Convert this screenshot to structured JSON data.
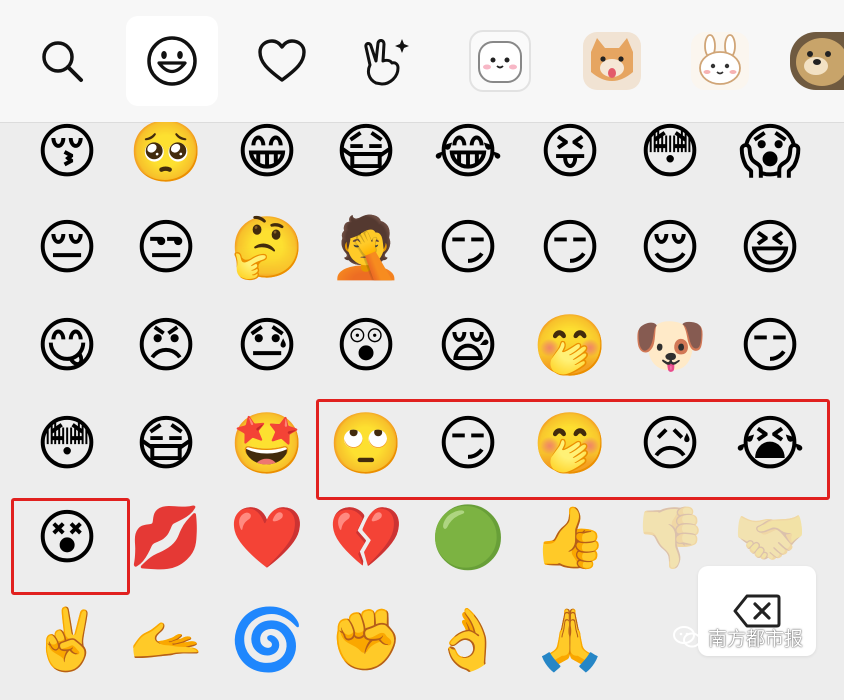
{
  "tabs": [
    {
      "name": "search-tab",
      "icon": "search-icon"
    },
    {
      "name": "emoji-tab",
      "icon": "smiley-face-icon",
      "active": true
    },
    {
      "name": "favorites-tab",
      "icon": "heart-icon"
    },
    {
      "name": "stickers-tab",
      "icon": "victory-hand-icon"
    },
    {
      "name": "sticker-pack-white-dog",
      "icon": "white-dog-sticker"
    },
    {
      "name": "sticker-pack-cat",
      "icon": "cat-sticker"
    },
    {
      "name": "sticker-pack-rabbit",
      "icon": "rabbit-sticker"
    },
    {
      "name": "sticker-pack-dog-photo",
      "icon": "dog-photo-sticker"
    }
  ],
  "emoji_rows": [
    [
      "😚",
      "🥺",
      "😁",
      "😷",
      "😂",
      "😝",
      "😳",
      "😱"
    ],
    [
      "😔",
      "😒",
      "🤔",
      "🤦",
      "😏",
      "😏",
      "😌",
      "😆"
    ],
    [
      "😋",
      "😠",
      "😓",
      "😲",
      "😪",
      "🤭",
      "🐶",
      "😏"
    ],
    [
      "😳",
      "😷",
      "🤩",
      "🙄",
      "😏",
      "🤭",
      "😥",
      "😭"
    ],
    [
      "😵",
      "💋",
      "❤️",
      "💔",
      "🟢",
      "👍",
      "👎",
      "🤝"
    ],
    [
      "✌️",
      "🫴",
      "🌀",
      "✊",
      "👌",
      "🙏",
      "",
      ""
    ]
  ],
  "highlight_groups": [
    {
      "label": "new-emoji-group-row4",
      "emojis": [
        "🙄",
        "😏",
        "🤭",
        "😥",
        "😭"
      ]
    },
    {
      "label": "new-emoji-single",
      "emojis": [
        "😵"
      ]
    }
  ],
  "delete_key": {
    "icon": "backspace-icon"
  },
  "watermark": {
    "icon": "wechat-icon",
    "text": "南方都市报"
  },
  "colors": {
    "tabbar_bg": "#f7f7f7",
    "grid_bg": "#ededed",
    "highlight": "#e1211f",
    "active_tab_bg": "#ffffff"
  }
}
